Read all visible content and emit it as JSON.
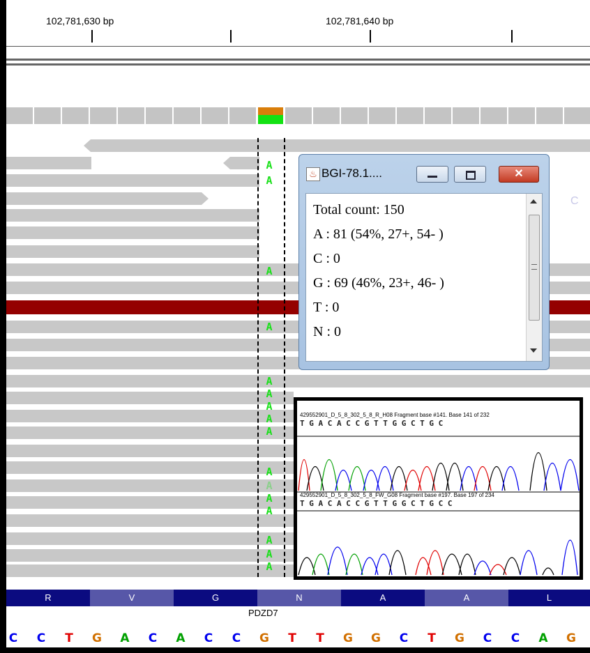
{
  "ruler": {
    "left_label": "102,781,630 bp",
    "right_label": "102,781,640 bp"
  },
  "popup": {
    "title": "BGI-78.1....",
    "lines": [
      "Total count: 150",
      "A : 81 (54%, 27+, 54- )",
      "C : 0",
      "G : 69 (46%, 23+, 46- )",
      "T : 0",
      "N : 0"
    ],
    "faint_letter": "C"
  },
  "chromatogram": {
    "trace1_caption": "429552901_D_5_8_302_5_8_R_H08 Fragment base #141. Base 141 of 232",
    "trace2_caption": "429552901_D_5_8_302_5_8_FW_G08 Fragment base #197. Base 197 of 234",
    "trace1_bases": "T  G  A C A C C G T T G G C T G C",
    "trace2_bases": "T  G  A  C  A  C  C G T T G  G  C  T  G  C  C"
  },
  "read_base": "A",
  "amino_acids": [
    "R",
    "V",
    "G",
    "N",
    "A",
    "A",
    "L"
  ],
  "gene_name": "PDZD7",
  "nucleotides": [
    "C",
    "C",
    "T",
    "G",
    "A",
    "C",
    "A",
    "C",
    "C",
    "G",
    "T",
    "T",
    "G",
    "G",
    "C",
    "T",
    "G",
    "C",
    "C",
    "A",
    "G"
  ],
  "colors": {
    "A": "#00a000",
    "C": "#0000ee",
    "G": "#d17000",
    "T": "#e00000",
    "aa_dark": "#0b0b80",
    "aa_light": "#5757a8"
  }
}
